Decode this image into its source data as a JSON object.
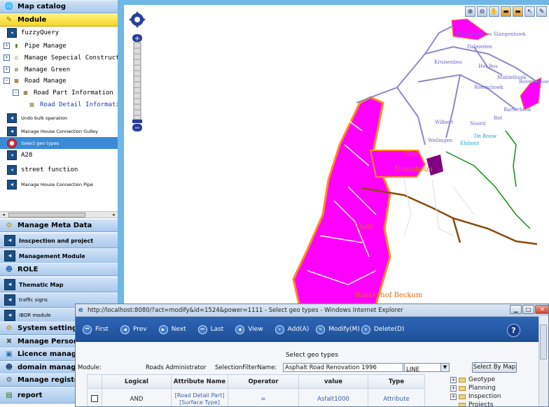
{
  "sidebar": {
    "map_catalog": "Map catalog",
    "module": "Module",
    "tree": [
      {
        "label": "fuzzyQuery",
        "kind": "item"
      },
      {
        "label": "Pipe Manage",
        "kind": "group"
      },
      {
        "label": "Manage Sepecial Construct",
        "kind": "group"
      },
      {
        "label": "Manage Green",
        "kind": "group"
      },
      {
        "label": "Road Manage",
        "kind": "group"
      },
      {
        "label": "Road Part Information",
        "kind": "subgroup"
      },
      {
        "label": "Road Detail Informati",
        "kind": "leaf"
      },
      {
        "label": "Undo bulk operation",
        "kind": "item-small"
      },
      {
        "label": "Manage House Connection Gulley",
        "kind": "item-small"
      },
      {
        "label": "Select geo types",
        "kind": "selected"
      },
      {
        "label": "A28",
        "kind": "item"
      },
      {
        "label": "street function",
        "kind": "item"
      },
      {
        "label": "Manage House Connection Pipe",
        "kind": "item-small"
      }
    ],
    "sections": [
      "Manage Meta Data",
      "Inscpection and project",
      "Management Module",
      "ROLE",
      "Thematic Map",
      "traffic signs",
      "IBOR module",
      "System setting",
      "Manage Personal",
      "Licence manager",
      "domain manager",
      "Manage registers",
      "report"
    ]
  },
  "map": {
    "place_labels": [
      "Dalmeden",
      "Kruisenbos",
      "Hei Bos",
      "Middelhoek",
      "Boveneshoek",
      "Roerschoek",
      "Barterbrok",
      "Noord",
      "Rot",
      "Wilbert",
      "Weilingen",
      "De Rouw",
      "Elshout",
      "Giel",
      "Nivenheim",
      "Oost",
      "Bakkerhof Beckum",
      "Bimbergenbos Slangenhoek"
    ]
  },
  "dialog": {
    "title": "http://localhost:8080/?act=modify&id=1524&power=1111 - Select geo types - Windows Internet Explorer",
    "nav": {
      "first": "First",
      "prev": "Prev",
      "next": "Next",
      "last": "Last",
      "view": "View",
      "add": "Add(A)",
      "modify": "Modify(M)",
      "delete": "Delete(D)"
    },
    "heading": "Select geo types",
    "filter": {
      "module_label": "Module:",
      "module_value": "Roads Administrator",
      "selection_label": "SelectionFilterName:",
      "selection_value": "Asphalt Road Renovation 1996",
      "type_value": "LINE",
      "select_btn": "Select By Map"
    },
    "table": {
      "headers": [
        "Logical",
        "Attribute Name",
        "Operator",
        "value",
        "Type"
      ],
      "rows": [
        {
          "logical": "AND",
          "attr_line1": "[Road Detail Part]",
          "attr_line2": "[Surface Type]",
          "operator": "=",
          "value": "Asfalt1000",
          "type": "Attribute"
        }
      ]
    },
    "geotree": [
      "Geotype",
      "Planning",
      "Inspection",
      "Projects"
    ]
  },
  "colors": {
    "sidebar_header": "#a9c9ec",
    "active_header": "#f5d52a",
    "selected_item": "#3a8ad6",
    "map_magenta": "#ff00ff",
    "map_orange": "#ff8c1a",
    "dialog_nav": "#1e4f96"
  }
}
